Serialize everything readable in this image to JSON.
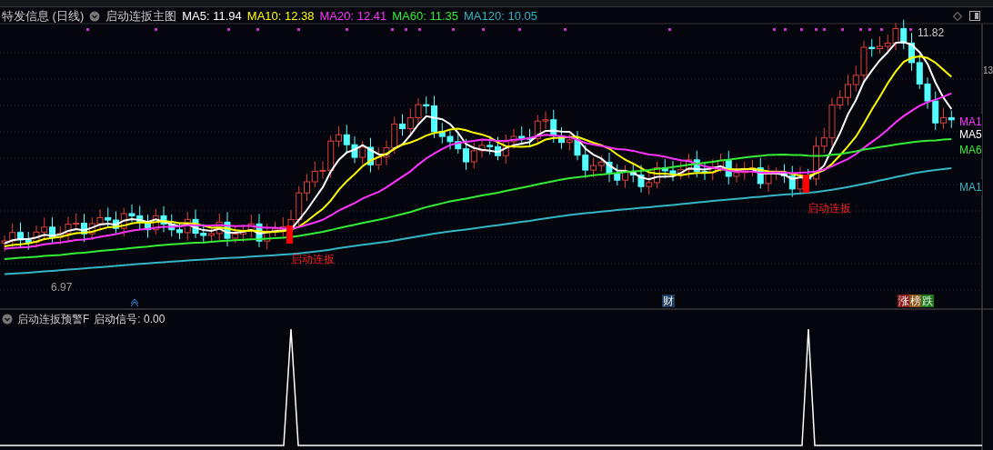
{
  "header": {
    "title": "特发信息 (日线)",
    "indicator": "启动连扳主图",
    "ma": [
      {
        "label": "MA5: 11.94",
        "color": "#ffffff"
      },
      {
        "label": "MA10: 12.38",
        "color": "#ffff00"
      },
      {
        "label": "MA20: 12.41",
        "color": "#ff33ff"
      },
      {
        "label": "MA60: 11.35",
        "color": "#33ee33"
      },
      {
        "label": "MA120: 10.05",
        "color": "#33b5c5"
      }
    ]
  },
  "main_chart": {
    "high_label": "11.82",
    "low_label": "6.97",
    "axis_labels": [
      "13"
    ],
    "line_labels": [
      {
        "text": "MA1",
        "color": "#ff33ff"
      },
      {
        "text": "MA5",
        "color": "#ffffff"
      },
      {
        "text": "MA6",
        "color": "#33ee33"
      },
      {
        "text": "MA1",
        "color": "#33b5c5"
      }
    ],
    "signals": [
      "启动连扳",
      "启动连扳"
    ],
    "events": [
      {
        "text": "财",
        "color": "#1b3a5c"
      },
      {
        "text": "涨",
        "color": "#8b1a1a"
      },
      {
        "text": "榜",
        "color": "#8b5a1a"
      },
      {
        "text": "跌",
        "color": "#1a7a1a"
      }
    ]
  },
  "sub_panel": {
    "title": "启动连扳预警F",
    "reading": "启动信号: 0.00"
  }
}
